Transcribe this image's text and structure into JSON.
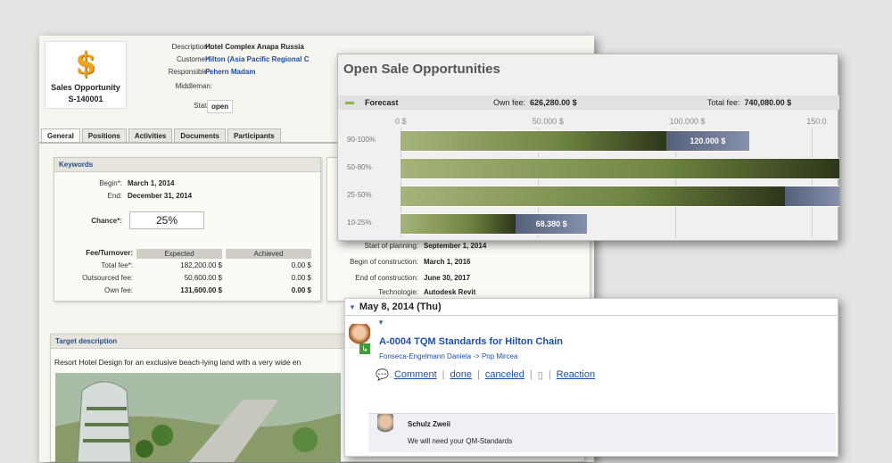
{
  "opportunity": {
    "logo_title": "Sales Opportunity",
    "logo_id": "S-140001",
    "fields": [
      {
        "label": "Description*:",
        "value": "Hotel Complex Anapa Russia"
      },
      {
        "label": "Customer*:",
        "value": "Hilton  (Asia Pacific Regional C"
      },
      {
        "label": "Responsible*:",
        "value": "Fehern Madam"
      },
      {
        "label": "Middleman:",
        "value": ""
      }
    ],
    "status_label": "State:",
    "status_value": "open",
    "tabs": [
      "General",
      "Positions",
      "Activities",
      "Documents",
      "Participants"
    ],
    "keywords": {
      "title": "Keywords",
      "begin_label": "Begin*:",
      "begin": "March 1, 2014",
      "end_label": "End:",
      "end": "December 31, 2014",
      "chance_label": "Chance*:",
      "chance": "25%",
      "fee_label": "Fee/Turnover:",
      "col_expected": "Expected",
      "col_achieved": "Achieved",
      "rows": [
        {
          "label": "Total fee*:",
          "expected": "182,200.00 $",
          "achieved": "0.00 $"
        },
        {
          "label": "Outsourced fee:",
          "expected": "50,600.00 $",
          "achieved": "0.00 $"
        },
        {
          "label": "Own fee:",
          "expected": "131,600.00 $",
          "achieved": "0.00 $"
        }
      ]
    },
    "schedule": [
      {
        "label": "Start of planning:",
        "value": "September 1, 2014"
      },
      {
        "label": "Begin of construction:",
        "value": "March 1, 2016"
      },
      {
        "label": "End of construction:",
        "value": "June 30, 2017"
      },
      {
        "label": "Technologie:",
        "value": "Autodesk Revit"
      }
    ],
    "target": {
      "title": "Target description",
      "text": "Resort Hotel Design for an exclusive beach-lying land with a very wide en"
    }
  },
  "chart_panel": {
    "title": "Open Sale Opportunities",
    "forecast_label": "Forecast",
    "own_fee_label": "Own fee:",
    "own_fee": "626,280.00 $",
    "total_fee_label": "Total fee:",
    "total_fee": "740,080.00 $"
  },
  "chart_data": {
    "type": "bar",
    "orientation": "horizontal",
    "stacked": true,
    "categories": [
      "90-100%",
      "50-80%",
      "25-50%",
      "10-25%"
    ],
    "xlim": [
      0,
      160000
    ],
    "tick_labels": [
      "0 $",
      "50.000 $",
      "100.000 $",
      "150.0"
    ],
    "series": [
      {
        "name": "",
        "color": "#6f8540",
        "values": [
          97000,
          160000,
          140000,
          42000
        ]
      },
      {
        "name": "",
        "color": "#6a7593",
        "values": [
          30000,
          0,
          22000,
          26000
        ]
      }
    ],
    "data_labels": [
      "120.000 $",
      "",
      "",
      "68.380 $"
    ]
  },
  "activity": {
    "date": "May 8, 2014 (Thu)",
    "title": "A-0004 TQM Standards for Hilton Chain",
    "subtitle": "Fonseca-Engelmann Daniela -> Pop Mircea",
    "actions": [
      "Comment",
      "done",
      "canceled",
      "Reaction"
    ],
    "comment_author": "Schulz Zweii",
    "comment_text": "We will need your QM-Standards"
  },
  "colors": {
    "link": "#1c50a7",
    "bar_green": "#6f8540",
    "bar_gray": "#6a7593"
  }
}
